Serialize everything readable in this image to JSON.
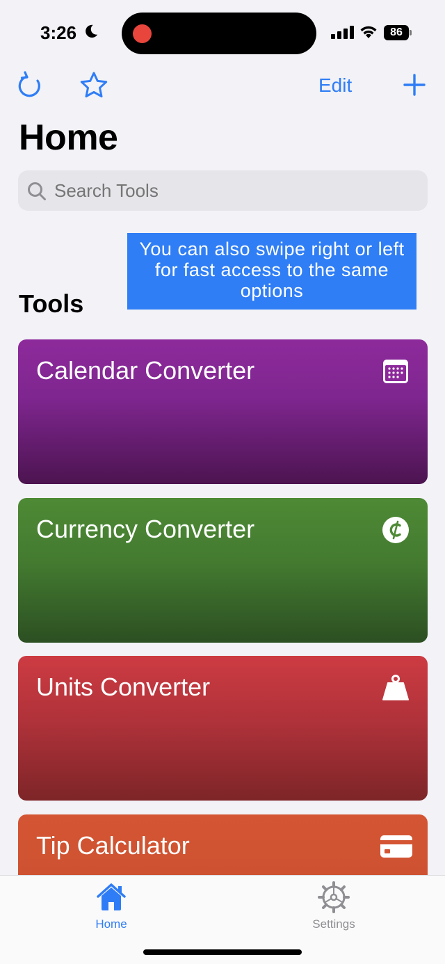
{
  "status_bar": {
    "time": "3:26",
    "battery": "86"
  },
  "nav": {
    "edit_label": "Edit",
    "refresh_icon": "refresh-icon",
    "star_icon": "star-icon",
    "add_icon": "plus-icon"
  },
  "page": {
    "title": "Home",
    "search_placeholder": "Search Tools",
    "section_title": "Tools"
  },
  "tooltip": {
    "text": "You can also swipe right or left for fast access to the same options"
  },
  "tools": [
    {
      "title": "Calendar Converter",
      "icon": "calendar-icon",
      "color": "#8d2a9b"
    },
    {
      "title": "Currency Converter",
      "icon": "currency-icon",
      "color": "#4e8a35"
    },
    {
      "title": "Units Converter",
      "icon": "weight-icon",
      "color": "#cd3b42"
    },
    {
      "title": "Tip Calculator",
      "icon": "credit-card-icon",
      "color": "#d45533"
    }
  ],
  "tab_bar": {
    "home_label": "Home",
    "settings_label": "Settings",
    "active_color": "#2f7df6",
    "inactive_color": "#8e8e93"
  }
}
